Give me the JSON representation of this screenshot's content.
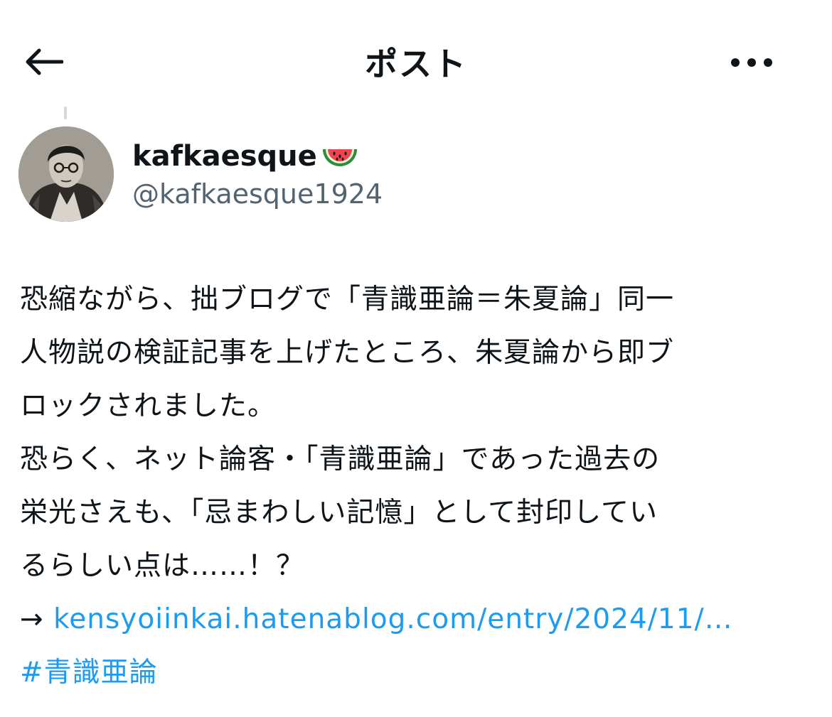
{
  "header": {
    "title": "ポスト",
    "back_icon": "arrow-left-icon",
    "more_icon": "more-horizontal-icon"
  },
  "author": {
    "display_name": "kafkaesque",
    "emoji_icon": "watermelon-icon",
    "handle": "@kafkaesque1924"
  },
  "post": {
    "lines": [
      "恐縮ながら、拙ブログで「青識亜論＝朱夏論」同一",
      "人物説の検証記事を上げたところ、朱夏論から即ブ",
      "ロックされました。",
      "恐らく、ネット論客・「青識亜論」であった過去の",
      "栄光さえも、「忌まわしい記憶」として封印してい",
      "るらしい点は……！？"
    ],
    "arrow": "→ ",
    "link_text": "kensyoiinkai.hatenablog.com/entry/2024/11/…",
    "hashtag": "#青識亜論"
  },
  "colors": {
    "text": "#0f1419",
    "secondary": "#536471",
    "link": "#1d9bf0"
  }
}
